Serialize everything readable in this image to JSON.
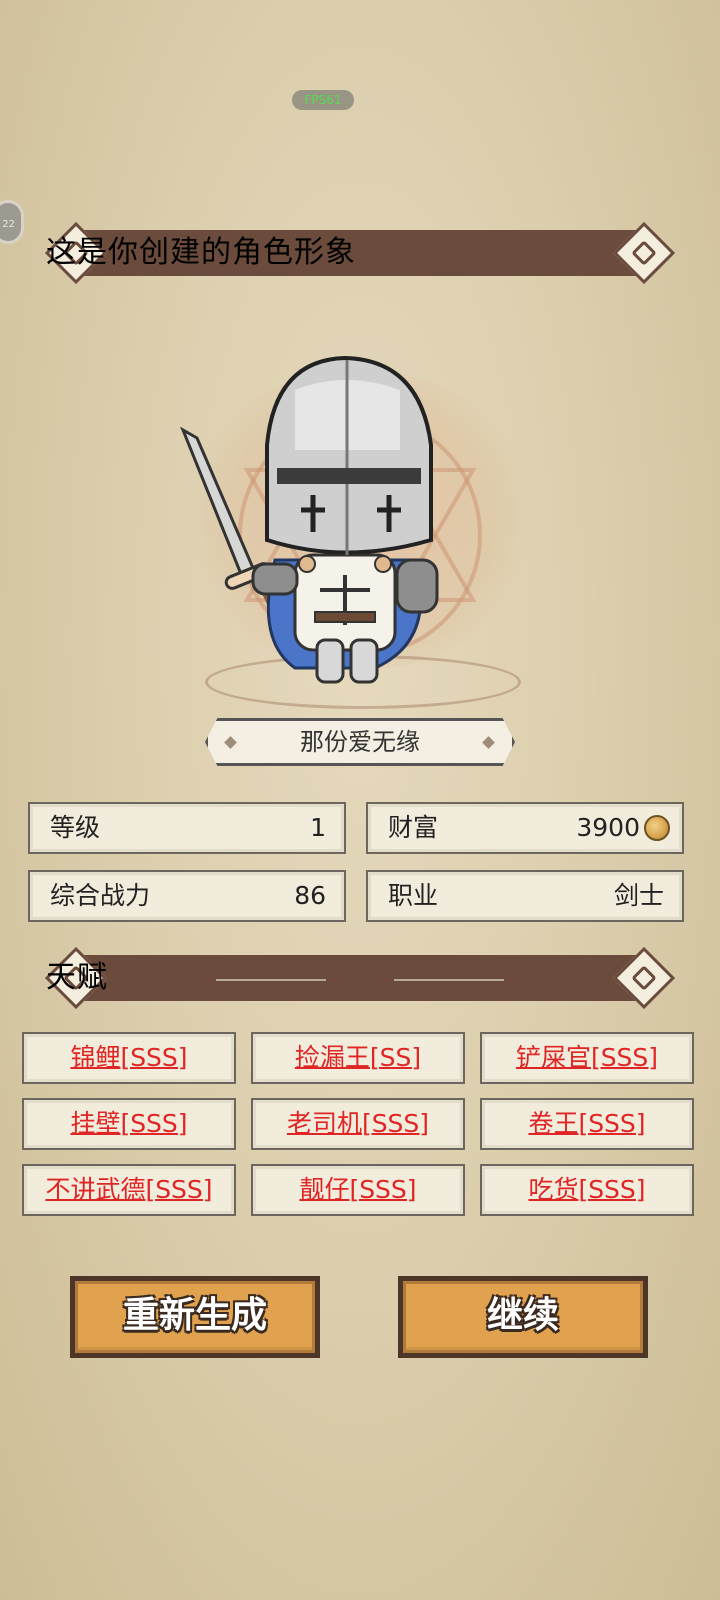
{
  "hud": {
    "fps": "FPS61",
    "bubble": "22"
  },
  "header": {
    "title": "这是你创建的角色形象"
  },
  "character": {
    "name": "那份爱无缘"
  },
  "stats": {
    "level": {
      "label": "等级",
      "value": "1"
    },
    "wealth": {
      "label": "财富",
      "value": "3900"
    },
    "power": {
      "label": "综合战力",
      "value": "86"
    },
    "job": {
      "label": "职业",
      "value": "剑士"
    }
  },
  "talent_section": {
    "title": "天赋"
  },
  "talents": [
    "锦鲤[SSS]",
    "捡漏王[SS]",
    "铲屎官[SSS]",
    "挂壁[SSS]",
    "老司机[SSS]",
    "卷王[SSS]",
    "不讲武德[SSS]",
    "靓仔[SSS]",
    "吃货[SSS]"
  ],
  "buttons": {
    "regenerate": "重新生成",
    "continue": "继续"
  },
  "colors": {
    "banner": "#6a4b3c",
    "talent_text": "#e02525",
    "button": "#e0a24e",
    "background": "#dccfae"
  }
}
